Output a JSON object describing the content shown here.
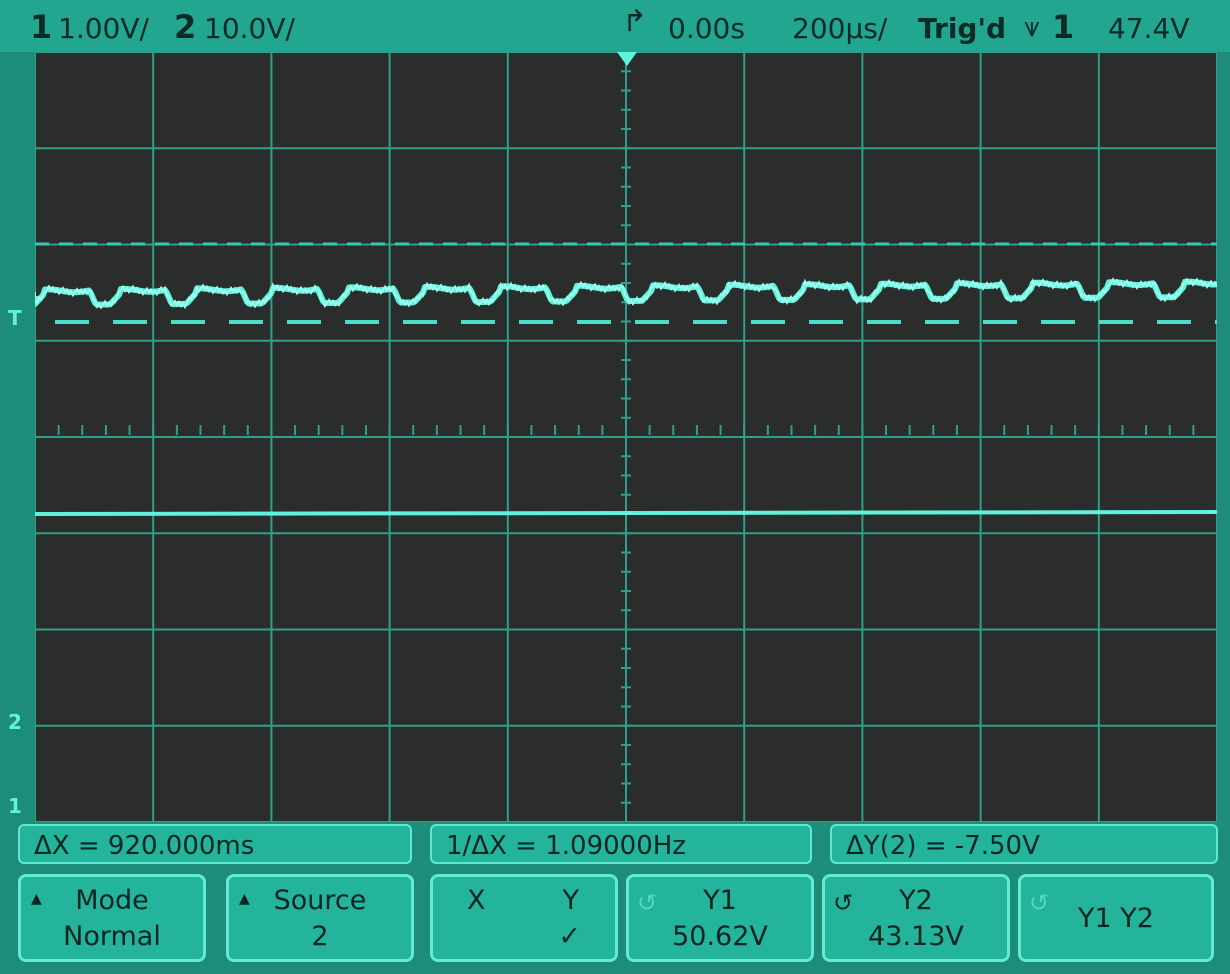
{
  "header": {
    "ch1_num": "1",
    "ch1_scale": "1.00V/",
    "ch2_num": "2",
    "ch2_scale": "10.0V/",
    "time_delay": "0.00s",
    "time_scale": "200µs/",
    "trigger_status": "Trig'd",
    "trigger_channel": "1",
    "trigger_level": "47.4V"
  },
  "markers": {
    "trigger_level": "T",
    "ch2_ground": "2",
    "ch1_ground": "1"
  },
  "readouts": {
    "delta_x": "ΔX = 920.000ms",
    "inv_delta_x": "1/ΔX = 1.09000Hz",
    "delta_y": "ΔY(2) = -7.50V"
  },
  "softkeys": {
    "mode_title": "Mode",
    "mode_value": "Normal",
    "source_title": "Source",
    "source_value": "2",
    "x_label": "X",
    "y_label": "Y",
    "y_check": "✓",
    "y1_title": "Y1",
    "y1_value": "50.62V",
    "y2_title": "Y2",
    "y2_value": "43.13V",
    "y1y2_title": "Y1 Y2"
  },
  "colors": {
    "trace": "#5ff3dc",
    "screen": "#2b2d2c",
    "grid": "#2f9f8b",
    "bezel": "#22a690"
  }
}
